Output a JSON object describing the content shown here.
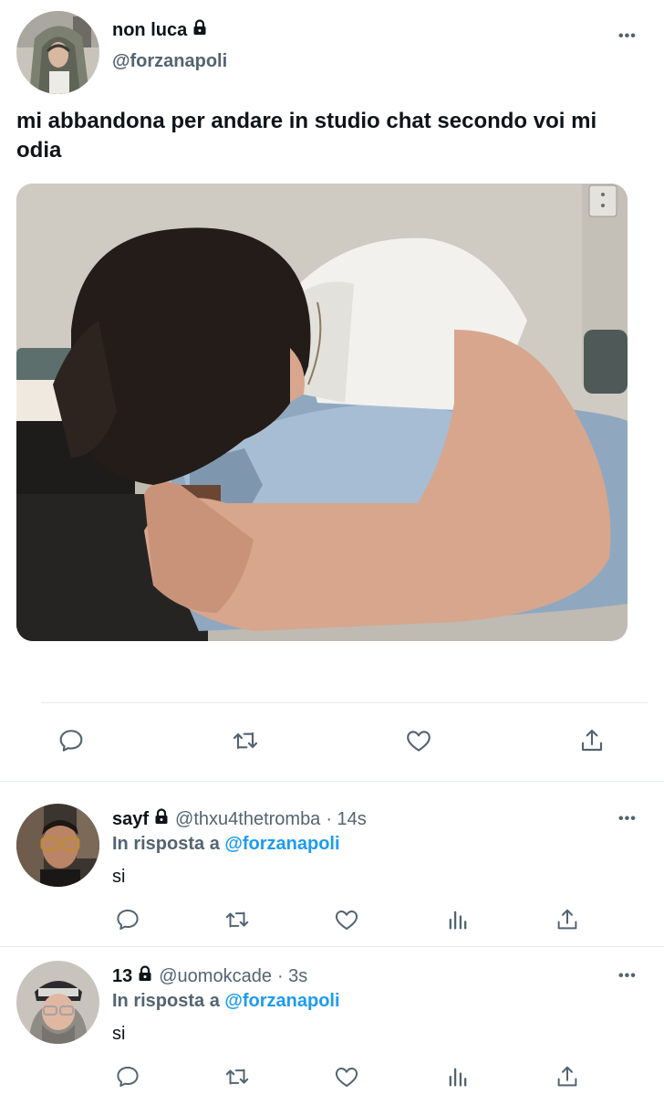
{
  "main_tweet": {
    "author_name": "non luca",
    "author_handle": "@forzanapoli",
    "text": "mi abbandona per andare in studio chat secondo voi mi odia",
    "more_label": "•••",
    "actions": [
      "reply-icon",
      "retweet-icon",
      "like-icon",
      "share-icon"
    ]
  },
  "replies": [
    {
      "author_name": "sayf",
      "author_handle": "@thxu4thetromba",
      "time": "· 14s",
      "reply_prefix": "In risposta a",
      "reply_mention": "@forzanapoli",
      "text": "si",
      "more_label": "•••",
      "actions": [
        "reply-icon",
        "retweet-icon",
        "like-icon",
        "analytics-icon",
        "share-icon"
      ]
    },
    {
      "author_name": "13",
      "author_handle": "@uomokcade",
      "time": "· 3s",
      "reply_prefix": "In risposta a",
      "reply_mention": "@forzanapoli",
      "text": "si",
      "more_label": "•••",
      "actions": [
        "reply-icon",
        "retweet-icon",
        "like-icon",
        "analytics-icon",
        "share-icon"
      ]
    }
  ],
  "colors": {
    "text": "#0f1419",
    "secondary": "#536471",
    "link": "#1d9bf0",
    "divider": "#e6e9eb"
  }
}
